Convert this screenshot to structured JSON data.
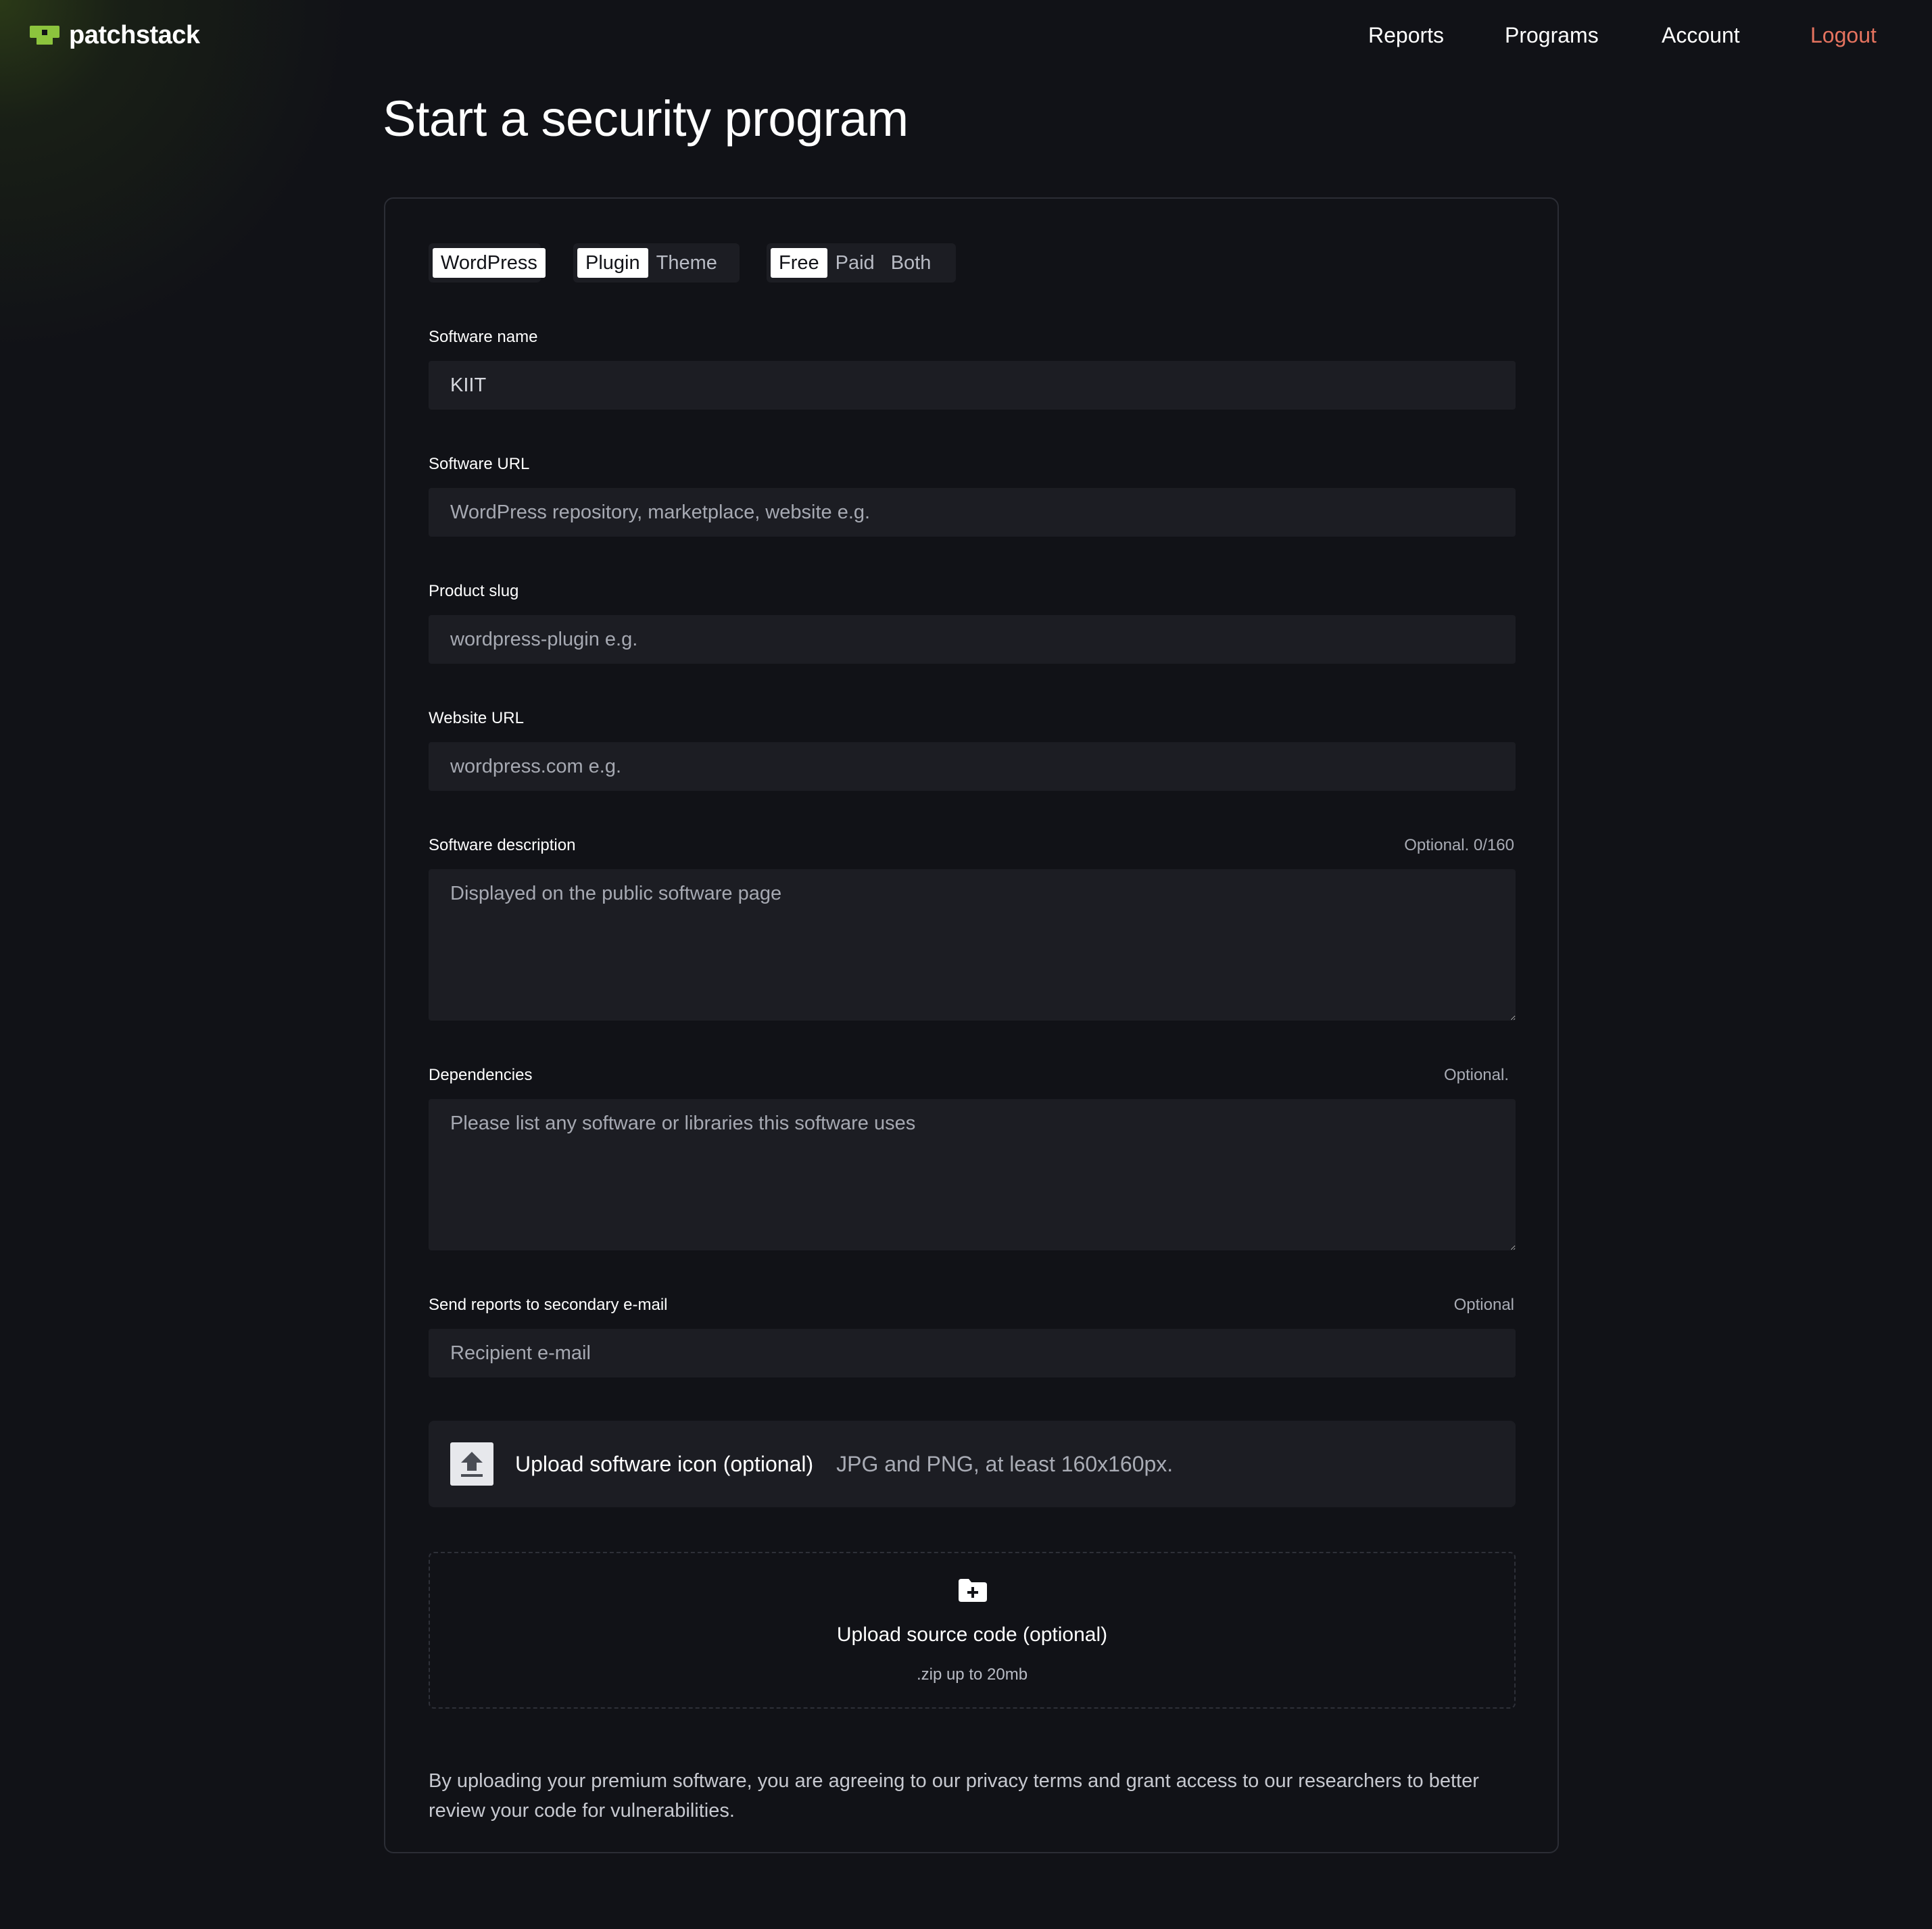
{
  "brand": {
    "name": "patchstack",
    "accent": "#8cc43d"
  },
  "nav": {
    "reports": "Reports",
    "programs": "Programs",
    "account": "Account",
    "logout": "Logout",
    "logout_color": "#e5735f"
  },
  "page": {
    "title": "Start a security program"
  },
  "selectors": {
    "platform": {
      "options": [
        "WordPress"
      ],
      "selected": "WordPress"
    },
    "type": {
      "options": [
        "Plugin",
        "Theme"
      ],
      "selected": "Plugin"
    },
    "pricing": {
      "options": [
        "Free",
        "Paid",
        "Both"
      ],
      "selected": "Free"
    }
  },
  "form": {
    "software_name": {
      "label": "Software name",
      "value": "KIIT"
    },
    "software_url": {
      "label": "Software URL",
      "placeholder": "WordPress repository, marketplace, website e.g."
    },
    "product_slug": {
      "label": "Product slug",
      "placeholder": "wordpress-plugin e.g."
    },
    "website_url": {
      "label": "Website URL",
      "placeholder": "wordpress.com e.g."
    },
    "description": {
      "label": "Software description",
      "note": "Optional. 0/160",
      "placeholder": "Displayed on the public software page"
    },
    "dependencies": {
      "label": "Dependencies",
      "note": "Optional.",
      "placeholder": "Please list any software or libraries this software uses"
    },
    "secondary_email": {
      "label": "Send reports to secondary e-mail",
      "note": "Optional",
      "placeholder": "Recipient e-mail"
    }
  },
  "uploads": {
    "icon": {
      "title": "Upload software icon (optional)",
      "hint": "JPG and PNG, at least 160x160px.",
      "icon": "upload-arrow-icon"
    },
    "source": {
      "title": "Upload source code (optional)",
      "hint": ".zip up to 20mb",
      "icon": "folder-add-icon"
    }
  },
  "disclaimer": "By uploading your premium software, you are agreeing to our privacy terms and grant access to our researchers to better review your code for vulnerabilities."
}
